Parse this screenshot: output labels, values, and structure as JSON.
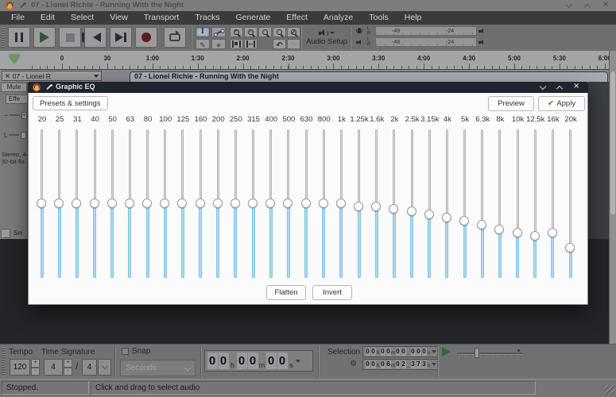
{
  "window": {
    "title": "07 - Lionel Richie - Running With the Night"
  },
  "menu": {
    "items": [
      "File",
      "Edit",
      "Select",
      "View",
      "Transport",
      "Tracks",
      "Generate",
      "Effect",
      "Analyze",
      "Tools",
      "Help"
    ]
  },
  "transport": {
    "buttons": [
      {
        "id": "pause",
        "icon": "pause-icon"
      },
      {
        "id": "play",
        "icon": "play-icon"
      },
      {
        "id": "stop",
        "icon": "stop-icon"
      },
      {
        "id": "skip-start",
        "icon": "skip-to-start-icon"
      },
      {
        "id": "skip-end",
        "icon": "skip-to-end-icon"
      },
      {
        "id": "record",
        "icon": "record-icon"
      },
      {
        "id": "loop",
        "icon": "loop-icon"
      }
    ]
  },
  "audio_setup": {
    "label": "Audio Setup"
  },
  "meters": {
    "rows": [
      {
        "icon": "microphone-icon",
        "channels": [
          "L",
          "R"
        ],
        "scale": [
          "-48",
          "-24"
        ]
      },
      {
        "icon": "speaker-icon",
        "channels": [
          "L",
          "R"
        ],
        "scale": [
          "-48",
          "-24"
        ]
      }
    ]
  },
  "timeline": {
    "ticks": [
      "0",
      "30",
      "1:00",
      "1:30",
      "2:00",
      "2:30",
      "3:00",
      "3:30",
      "4:00",
      "4:30",
      "5:00",
      "5:30",
      "6:00"
    ]
  },
  "track": {
    "tab_label": "07 - Lionel R",
    "clip_title": "07 - Lionel Richie - Running With the Night",
    "panel": {
      "mute": "Mute",
      "effects": "Effe",
      "gain_min": "−",
      "gain_thumb": "+",
      "pan_left": "L",
      "info_line1": "Stereo, 44",
      "info_line2": "32-bit flo",
      "select": "Sel"
    }
  },
  "eq_dialog": {
    "title": "Graphic EQ",
    "presets_button": "Presets & settings",
    "preview_button": "Preview",
    "apply_button": "Apply",
    "flatten_button": "Flatten",
    "invert_button": "Invert",
    "bands": [
      {
        "freq": "20",
        "gain_db": 0,
        "pos": 50
      },
      {
        "freq": "25",
        "gain_db": 0,
        "pos": 50
      },
      {
        "freq": "31",
        "gain_db": 0,
        "pos": 50
      },
      {
        "freq": "40",
        "gain_db": 0,
        "pos": 50
      },
      {
        "freq": "50",
        "gain_db": 0,
        "pos": 50
      },
      {
        "freq": "63",
        "gain_db": 0,
        "pos": 50
      },
      {
        "freq": "80",
        "gain_db": 0,
        "pos": 50
      },
      {
        "freq": "100",
        "gain_db": 0,
        "pos": 50
      },
      {
        "freq": "125",
        "gain_db": 0,
        "pos": 50
      },
      {
        "freq": "160",
        "gain_db": 0,
        "pos": 50
      },
      {
        "freq": "200",
        "gain_db": 0,
        "pos": 50
      },
      {
        "freq": "250",
        "gain_db": 0,
        "pos": 50
      },
      {
        "freq": "315",
        "gain_db": 0,
        "pos": 50
      },
      {
        "freq": "400",
        "gain_db": 0,
        "pos": 50
      },
      {
        "freq": "500",
        "gain_db": 0,
        "pos": 50
      },
      {
        "freq": "630",
        "gain_db": 0,
        "pos": 50
      },
      {
        "freq": "800",
        "gain_db": 0,
        "pos": 50
      },
      {
        "freq": "1k",
        "gain_db": 0,
        "pos": 50
      },
      {
        "freq": "1.25k",
        "gain_db": -0.8,
        "pos": 52
      },
      {
        "freq": "1.6k",
        "gain_db": -0.8,
        "pos": 52
      },
      {
        "freq": "2k",
        "gain_db": -1.4,
        "pos": 53.5
      },
      {
        "freq": "2.5k",
        "gain_db": -2.2,
        "pos": 55.5
      },
      {
        "freq": "3.15k",
        "gain_db": -3,
        "pos": 57.5
      },
      {
        "freq": "4k",
        "gain_db": -3.8,
        "pos": 59.5
      },
      {
        "freq": "5k",
        "gain_db": -4.8,
        "pos": 62
      },
      {
        "freq": "6.3k",
        "gain_db": -5.8,
        "pos": 64.5
      },
      {
        "freq": "8k",
        "gain_db": -7,
        "pos": 67.5
      },
      {
        "freq": "10k",
        "gain_db": -8,
        "pos": 70
      },
      {
        "freq": "12.5k",
        "gain_db": -8.8,
        "pos": 72
      },
      {
        "freq": "16k",
        "gain_db": -7.8,
        "pos": 69.5
      },
      {
        "freq": "20k",
        "gain_db": -12,
        "pos": 80
      }
    ]
  },
  "bottom_bar": {
    "tempo": {
      "label": "Tempo",
      "value": "120"
    },
    "time_signature": {
      "label": "Time Signature",
      "upper": "4",
      "slash": "/",
      "lower": "4"
    },
    "snap": {
      "label": "Snap",
      "unit": "Seconds",
      "checked": false
    },
    "time_display": {
      "segments": [
        "00",
        "h",
        "00",
        "m",
        "00",
        "s"
      ]
    },
    "selection": {
      "label": "Selection",
      "start_segments": [
        "00",
        "h",
        "00",
        "m",
        "00",
        ",",
        "000",
        "s"
      ],
      "end_segments": [
        "00",
        "h",
        "06",
        "m",
        "02",
        ",",
        "373",
        "s"
      ]
    }
  },
  "status_bar": {
    "state": "Stopped.",
    "hint": "Click and drag to select audio"
  },
  "colors": {
    "dialog_titlebar": "#20242f",
    "eq_fill_blue": "#abdaf3",
    "apply_check_green": "#4e9a06",
    "record_red": "#5c1d1d",
    "play_green": "#2f5a36",
    "ruler_marker_green": "#679a58"
  }
}
